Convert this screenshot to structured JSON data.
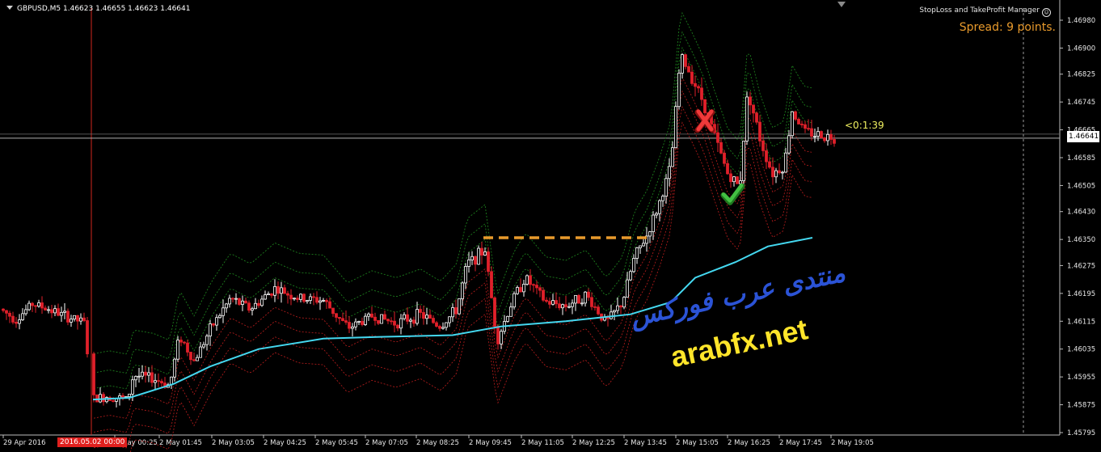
{
  "header": {
    "symbol_line": "GBPUSD,M5  1.46623 1.46655 1.46623 1.46641"
  },
  "expert": {
    "name": "StopLoss and TakeProfit Manager",
    "spread_text": "Spread: 9 points."
  },
  "bar_timer": "<0:1:39",
  "current_price_tag": "1.46641",
  "watermark": {
    "arabic": "منتدى عرب فوركس",
    "site": "arabfx.net"
  },
  "highlighted_date": "2016.05.02 00:00",
  "colors": {
    "bull": "#ffffff",
    "bear": "#e0202a",
    "ma": "#44d8f0",
    "channel_upper": "#1f8a1f",
    "channel_lower": "#c81e1e",
    "level": "#e89a2c",
    "grid": "#b0b0b0"
  },
  "chart_data": {
    "type": "candlestick",
    "symbol": "GBPUSD",
    "timeframe": "M5",
    "price_axis_ticks": [
      "1.46980",
      "1.46900",
      "1.46825",
      "1.46745",
      "1.46665",
      "1.46585",
      "1.46505",
      "1.46430",
      "1.46350",
      "1.46275",
      "1.46195",
      "1.46115",
      "1.46035",
      "1.45955",
      "1.45875",
      "1.45795"
    ],
    "time_axis_labels": [
      "29 Apr 2016",
      "2 May 00:25",
      "2 May 01:45",
      "2 May 03:05",
      "2 May 04:25",
      "2 May 05:45",
      "2 May 07:05",
      "2 May 08:25",
      "2 May 09:45",
      "2 May 11:05",
      "2 May 12:25",
      "2 May 13:45",
      "2 May 15:05",
      "2 May 16:25",
      "2 May 17:45",
      "2 May 19:05"
    ],
    "ylim": [
      1.45795,
      1.47005
    ],
    "current_price": 1.46641,
    "close_path": [
      {
        "t": 0,
        "p": 1.4615
      },
      {
        "t": 20,
        "p": 1.4612
      },
      {
        "t": 40,
        "p": 1.46165
      },
      {
        "t": 60,
        "p": 1.4615
      },
      {
        "t": 80,
        "p": 1.4613
      },
      {
        "t": 105,
        "p": 1.4611
      },
      {
        "t": 113,
        "p": 1.4589
      },
      {
        "t": 135,
        "p": 1.459
      },
      {
        "t": 158,
        "p": 1.4589
      },
      {
        "t": 165,
        "p": 1.4596
      },
      {
        "t": 190,
        "p": 1.4595
      },
      {
        "t": 210,
        "p": 1.4593
      },
      {
        "t": 222,
        "p": 1.46075
      },
      {
        "t": 240,
        "p": 1.46
      },
      {
        "t": 262,
        "p": 1.461
      },
      {
        "t": 285,
        "p": 1.4618
      },
      {
        "t": 310,
        "p": 1.4615
      },
      {
        "t": 340,
        "p": 1.4621
      },
      {
        "t": 370,
        "p": 1.4618
      },
      {
        "t": 400,
        "p": 1.46175
      },
      {
        "t": 430,
        "p": 1.46095
      },
      {
        "t": 460,
        "p": 1.4613
      },
      {
        "t": 490,
        "p": 1.4611
      },
      {
        "t": 520,
        "p": 1.46135
      },
      {
        "t": 545,
        "p": 1.461
      },
      {
        "t": 565,
        "p": 1.4615
      },
      {
        "t": 578,
        "p": 1.4628
      },
      {
        "t": 600,
        "p": 1.4632
      },
      {
        "t": 615,
        "p": 1.4606
      },
      {
        "t": 635,
        "p": 1.4618
      },
      {
        "t": 650,
        "p": 1.4624
      },
      {
        "t": 675,
        "p": 1.4617
      },
      {
        "t": 700,
        "p": 1.4616
      },
      {
        "t": 725,
        "p": 1.4619
      },
      {
        "t": 750,
        "p": 1.4611
      },
      {
        "t": 770,
        "p": 1.4617
      },
      {
        "t": 785,
        "p": 1.463
      },
      {
        "t": 800,
        "p": 1.4636
      },
      {
        "t": 815,
        "p": 1.4645
      },
      {
        "t": 830,
        "p": 1.4656
      },
      {
        "t": 842,
        "p": 1.4688
      },
      {
        "t": 855,
        "p": 1.4682
      },
      {
        "t": 870,
        "p": 1.46745
      },
      {
        "t": 885,
        "p": 1.4664
      },
      {
        "t": 900,
        "p": 1.4654
      },
      {
        "t": 915,
        "p": 1.465
      },
      {
        "t": 925,
        "p": 1.4678
      },
      {
        "t": 940,
        "p": 1.4664
      },
      {
        "t": 955,
        "p": 1.4654
      },
      {
        "t": 970,
        "p": 1.4656
      },
      {
        "t": 980,
        "p": 1.4672
      },
      {
        "t": 995,
        "p": 1.4666
      },
      {
        "t": 1015,
        "p": 1.4665
      },
      {
        "t": 1035,
        "p": 1.46641
      }
    ],
    "moving_average": [
      {
        "t": 115,
        "p": 1.4589
      },
      {
        "t": 160,
        "p": 1.45895
      },
      {
        "t": 215,
        "p": 1.45935
      },
      {
        "t": 260,
        "p": 1.45985
      },
      {
        "t": 320,
        "p": 1.46035
      },
      {
        "t": 400,
        "p": 1.46065
      },
      {
        "t": 470,
        "p": 1.4607
      },
      {
        "t": 560,
        "p": 1.46075
      },
      {
        "t": 620,
        "p": 1.461
      },
      {
        "t": 700,
        "p": 1.46115
      },
      {
        "t": 780,
        "p": 1.46135
      },
      {
        "t": 830,
        "p": 1.4617
      },
      {
        "t": 860,
        "p": 1.4624
      },
      {
        "t": 910,
        "p": 1.46285
      },
      {
        "t": 950,
        "p": 1.4633
      },
      {
        "t": 1005,
        "p": 1.46355
      }
    ],
    "resistance_level": {
      "price": 1.46355,
      "from_t": 598,
      "to_t": 805
    },
    "trade_marks": [
      {
        "kind": "stop-loss-hit",
        "t": 872,
        "p": 1.4669
      },
      {
        "kind": "take-profit-hit",
        "t": 905,
        "p": 1.46475
      }
    ],
    "session_marker_t": 113,
    "future_marker_t": 1266
  }
}
